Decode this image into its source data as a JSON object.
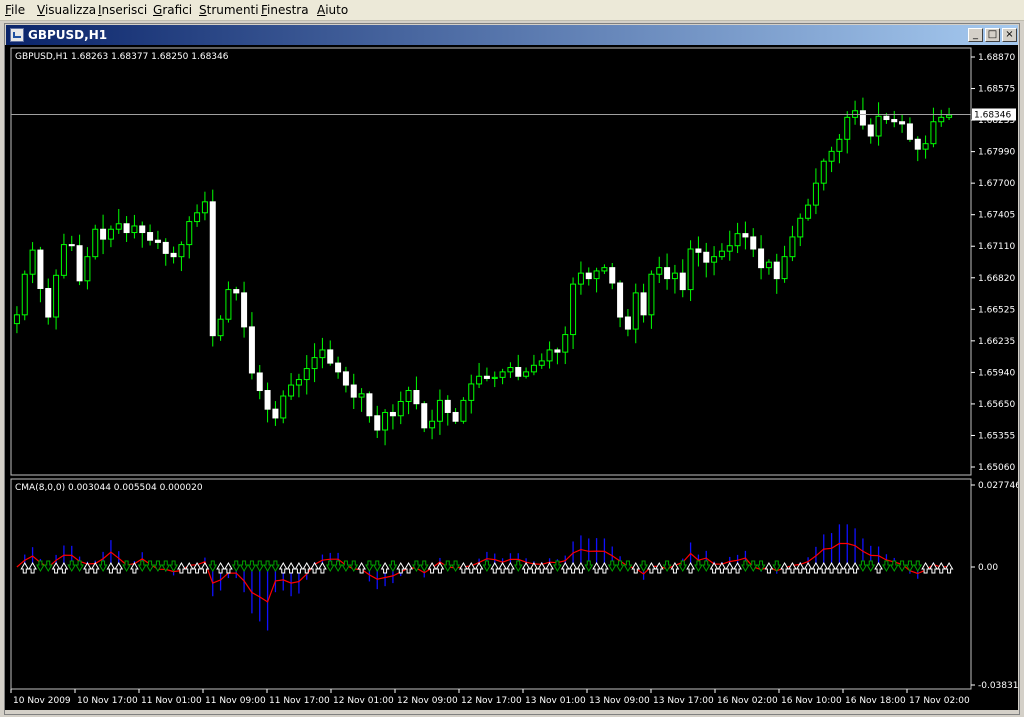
{
  "menu": [
    {
      "label": "File",
      "ul": "F",
      "rest": "ile"
    },
    {
      "label": "Visualizza",
      "ul": "V",
      "rest": "isualizza"
    },
    {
      "label": "Inserisci",
      "ul": "I",
      "rest": "nserisci"
    },
    {
      "label": "Grafici",
      "ul": "G",
      "rest": "rafici"
    },
    {
      "label": "Strumenti",
      "ul": "S",
      "rest": "trumenti"
    },
    {
      "label": "Finestra",
      "ul": "F",
      "rest": "inestra"
    },
    {
      "label": "Aiuto",
      "ul": "A",
      "rest": "iuto"
    }
  ],
  "window": {
    "title": "GBPUSD,H1"
  },
  "colors": {
    "bg": "#000000",
    "up": "#00ff00",
    "down": "#ffffff",
    "hist": "#1010ff",
    "cma": "#ff0000",
    "arrow_up": "#ffffff",
    "arrow_dn": "#00a000",
    "axis": "#ffffff"
  },
  "price_pane": {
    "label": "GBPUSD,H1  1.68263 1.68377 1.68250 1.68346",
    "current_price": "1.68346",
    "axis_labels": [
      "1.68870",
      "1.68575",
      "1.68235",
      "1.67990",
      "1.67700",
      "1.67405",
      "1.67110",
      "1.66820",
      "1.66525",
      "1.66235",
      "1.65940",
      "1.65650",
      "1.65355",
      "1.65060"
    ]
  },
  "indicator_pane": {
    "label": "CMA(8,0,0) 0.003044 0.005504 0.000020",
    "axis_labels": [
      "0.027746",
      "0.00",
      "-0.03831"
    ]
  },
  "time_axis": [
    "10 Nov 2009",
    "10 Nov 17:00",
    "11 Nov 01:00",
    "11 Nov 09:00",
    "11 Nov 17:00",
    "12 Nov 01:00",
    "12 Nov 09:00",
    "12 Nov 17:00",
    "13 Nov 01:00",
    "13 Nov 09:00",
    "13 Nov 17:00",
    "16 Nov 02:00",
    "16 Nov 10:00",
    "16 Nov 18:00",
    "17 Nov 02:00"
  ],
  "chart_data": {
    "type": "candlestick",
    "symbol": "GBPUSD",
    "timeframe": "H1",
    "y_range": [
      1.6506,
      1.6887
    ],
    "close": [
      1.6652,
      1.6689,
      1.6711,
      1.6676,
      1.665,
      1.6688,
      1.6716,
      1.6715,
      1.6683,
      1.6705,
      1.673,
      1.6721,
      1.673,
      1.6735,
      1.6727,
      1.6733,
      1.6727,
      1.672,
      1.6718,
      1.6708,
      1.6705,
      1.6716,
      1.6737,
      1.6745,
      1.6755,
      1.6633,
      1.6648,
      1.6675,
      1.6672,
      1.6641,
      1.6599,
      1.6583,
      1.6566,
      1.6558,
      1.6578,
      1.6588,
      1.6593,
      1.6603,
      1.6613,
      1.662,
      1.6608,
      1.66,
      1.6588,
      1.6577,
      1.658,
      1.656,
      1.6547,
      1.6563,
      1.656,
      1.6573,
      1.6583,
      1.6571,
      1.6549,
      1.6555,
      1.6574,
      1.6563,
      1.6555,
      1.6574,
      1.6589,
      1.6596,
      1.6594,
      1.6595,
      1.66,
      1.6604,
      1.6596,
      1.66,
      1.6606,
      1.661,
      1.662,
      1.6618,
      1.6634,
      1.668,
      1.669,
      1.6685,
      1.6692,
      1.6695,
      1.6681,
      1.665,
      1.6639,
      1.6672,
      1.6652,
      1.6689,
      1.6695,
      1.6685,
      1.669,
      1.6675,
      1.6712,
      1.6709,
      1.67,
      1.6705,
      1.671,
      1.6715,
      1.6726,
      1.6723,
      1.6712,
      1.6695,
      1.67,
      1.6685,
      1.6705,
      1.6723,
      1.674,
      1.6752,
      1.6772,
      1.6792,
      1.6801,
      1.6812,
      1.6832,
      1.6838,
      1.6825,
      1.6815,
      1.6833,
      1.683,
      1.6828,
      1.6826,
      1.6812,
      1.6803,
      1.6808,
      1.6828,
      1.6832,
      1.6834
    ],
    "volatility_note": "values read approximately from the chart",
    "indicator": {
      "name": "CMA(8,0,0)",
      "values": [
        0.003044,
        0.005504,
        2e-05
      ]
    }
  }
}
